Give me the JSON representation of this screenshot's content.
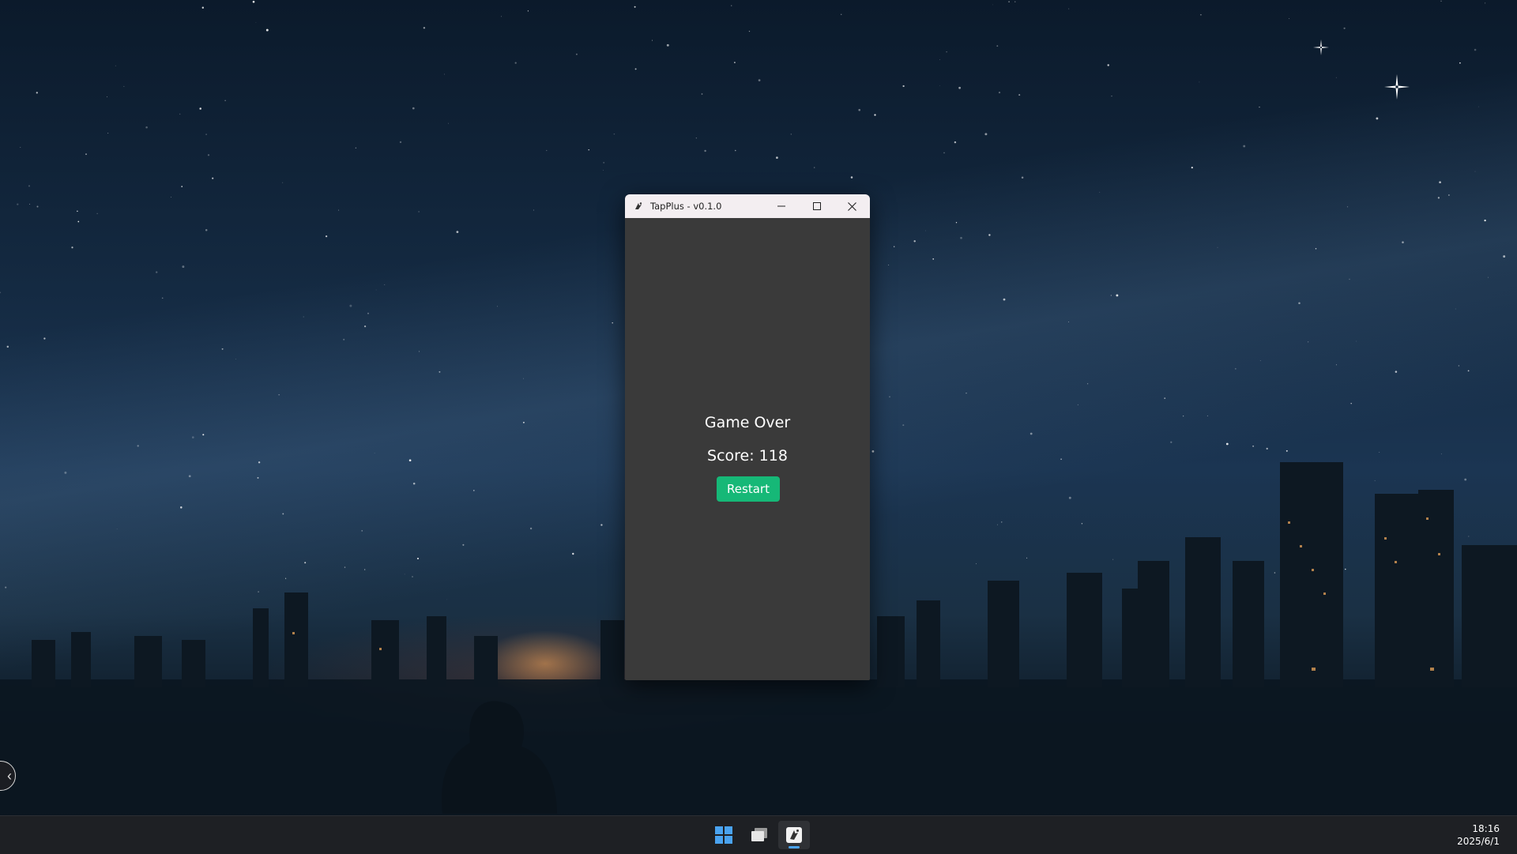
{
  "window": {
    "title": "TapPlus - v0.1.0",
    "minimize_icon": "minimize-icon",
    "maximize_icon": "maximize-icon",
    "close_icon": "close-icon"
  },
  "game": {
    "status_text": "Game Over",
    "score_text": "Score: 118",
    "restart_label": "Restart"
  },
  "taskbar": {
    "items": [
      {
        "name": "start",
        "icon": "windows-logo-icon"
      },
      {
        "name": "task-view",
        "icon": "task-view-icon"
      },
      {
        "name": "tapplus",
        "icon": "tapplus-app-icon",
        "active": true
      }
    ],
    "time": "18:16",
    "date": "2025/6/1"
  },
  "colors": {
    "restart_bg": "#16b877",
    "client_bg": "#3a3a3a",
    "titlebar_bg": "#f3eef1",
    "accent": "#4aa3f0"
  }
}
